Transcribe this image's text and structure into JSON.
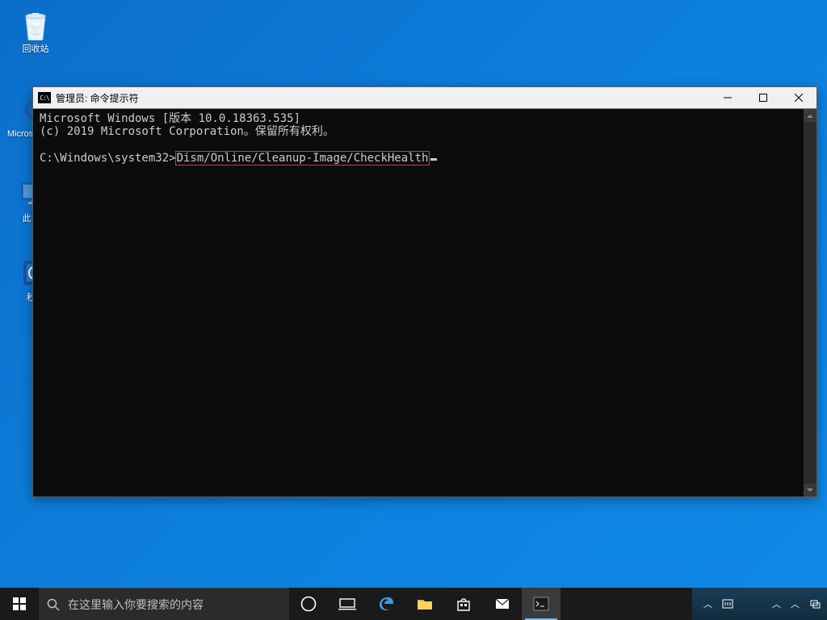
{
  "desktop": {
    "recycle_bin": "回收站",
    "edge": "Microsoft Ed...",
    "this_pc": "此电脑",
    "timer": "秒关"
  },
  "cmd": {
    "title": "管理员: 命令提示符",
    "line1": "Microsoft Windows [版本 10.0.18363.535]",
    "line2": "(c) 2019 Microsoft Corporation。保留所有权利。",
    "prompt": "C:\\Windows\\system32>",
    "command": "Dism/Online/Cleanup-Image/CheckHealth"
  },
  "taskbar": {
    "search_placeholder": "在这里输入你要搜索的内容"
  }
}
